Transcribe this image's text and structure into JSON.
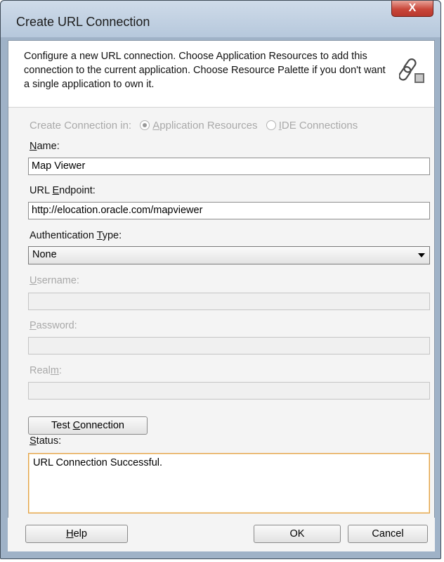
{
  "window": {
    "title": "Create URL Connection",
    "close_glyph": "X"
  },
  "intro": {
    "text": "Configure a new URL connection.  Choose Application Resources to add this connection to the current application. Choose Resource Palette if you don't want a single application to own it.",
    "icon": "chain-link-icon"
  },
  "create_in": {
    "label": "Create Connection in:",
    "options": [
      {
        "label_prefix": "",
        "mnemonic": "A",
        "label_rest": "pplication Resources",
        "selected": true
      },
      {
        "label_prefix": "",
        "mnemonic": "I",
        "label_rest": "DE Connections",
        "selected": false
      }
    ]
  },
  "name": {
    "label_mnemonic": "N",
    "label_rest": "ame:",
    "value": "Map Viewer"
  },
  "url": {
    "label_prefix": "URL ",
    "label_mnemonic": "E",
    "label_rest": "ndpoint:",
    "value": "http://elocation.oracle.com/mapviewer"
  },
  "auth": {
    "label_prefix": "Authentication ",
    "label_mnemonic": "T",
    "label_rest": "ype:",
    "value": "None"
  },
  "username": {
    "label_mnemonic": "U",
    "label_rest": "sername:",
    "value": ""
  },
  "password": {
    "label_mnemonic": "P",
    "label_rest": "assword:",
    "value": ""
  },
  "realm": {
    "label_prefix": "Real",
    "label_mnemonic": "m",
    "label_rest": ":",
    "value": ""
  },
  "test_button": {
    "label_prefix": "Test ",
    "label_mnemonic": "C",
    "label_rest": "onnection"
  },
  "status": {
    "label_mnemonic": "S",
    "label_rest": "tatus:",
    "value": "URL Connection Successful."
  },
  "footer": {
    "help": {
      "label_mnemonic": "H",
      "label_rest": "elp"
    },
    "ok": "OK",
    "cancel": "Cancel"
  },
  "colors": {
    "status_border": "#e3a248",
    "close_button": "#c9473a",
    "titlebar": "#b6c8dc"
  }
}
